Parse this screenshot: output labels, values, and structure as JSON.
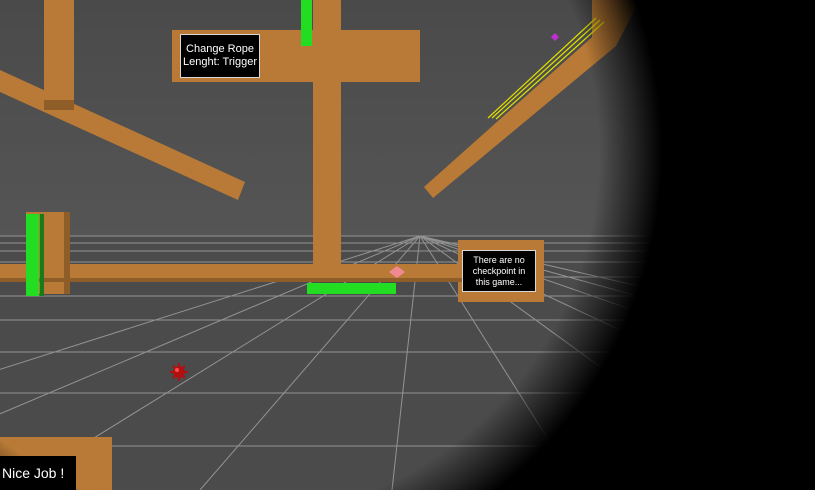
{
  "signs": {
    "rope": {
      "line1": "Change Rope",
      "line2": "Lenght: Trigger"
    },
    "checkpoint": {
      "line1": "There are no",
      "line2": "checkpoint in",
      "line3": "this game..."
    }
  },
  "hud": {
    "message": "Nice Job !"
  },
  "colors": {
    "platform": "#b87a36",
    "ground": "#4d4d4d",
    "grid": "#a8a8a8",
    "trigger_green": "#22dd22",
    "void": "#000000"
  },
  "icons": {
    "player": "red-spiked-ball-icon",
    "pickup": "purple-gem-icon",
    "marker": "pink-diamond-icon"
  }
}
